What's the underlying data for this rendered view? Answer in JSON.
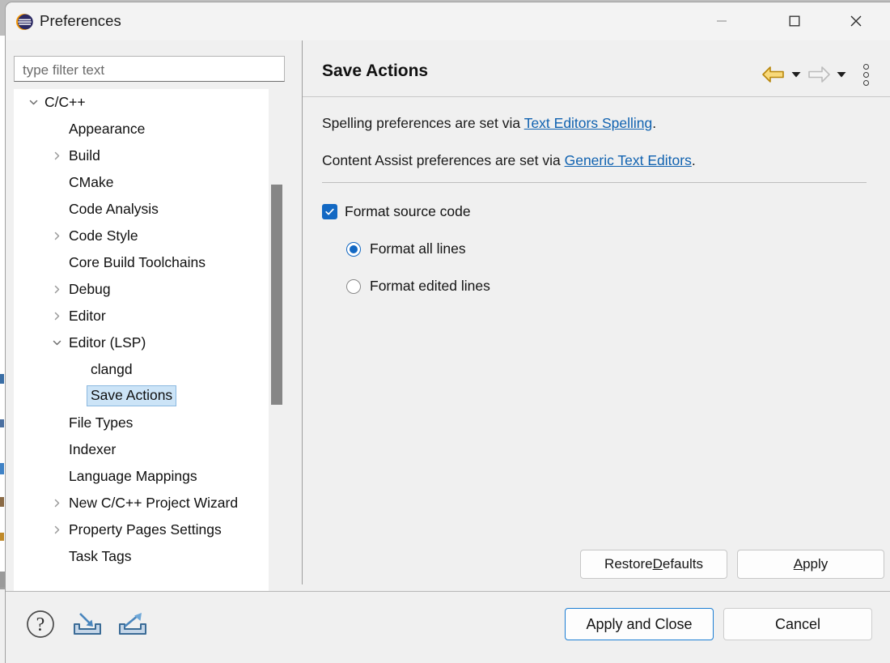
{
  "window": {
    "title": "Preferences",
    "app_icon": "eclipse-logo-icon",
    "controls": {
      "minimize": "minimize-icon",
      "maximize": "maximize-icon",
      "close": "close-icon"
    }
  },
  "sidebar": {
    "filter": {
      "value": "",
      "placeholder": "type filter text"
    },
    "tree": [
      {
        "label": "C/C++",
        "indent": 0,
        "twisty": "expanded",
        "selected": false
      },
      {
        "label": "Appearance",
        "indent": 1,
        "twisty": "none",
        "selected": false
      },
      {
        "label": "Build",
        "indent": 1,
        "twisty": "collapsed",
        "selected": false
      },
      {
        "label": "CMake",
        "indent": 1,
        "twisty": "none",
        "selected": false
      },
      {
        "label": "Code Analysis",
        "indent": 1,
        "twisty": "none",
        "selected": false
      },
      {
        "label": "Code Style",
        "indent": 1,
        "twisty": "collapsed",
        "selected": false
      },
      {
        "label": "Core Build Toolchains",
        "indent": 1,
        "twisty": "none",
        "selected": false
      },
      {
        "label": "Debug",
        "indent": 1,
        "twisty": "collapsed",
        "selected": false
      },
      {
        "label": "Editor",
        "indent": 1,
        "twisty": "collapsed",
        "selected": false
      },
      {
        "label": "Editor (LSP)",
        "indent": 1,
        "twisty": "expanded",
        "selected": false
      },
      {
        "label": "clangd",
        "indent": 2,
        "twisty": "none",
        "selected": false
      },
      {
        "label": "Save Actions",
        "indent": 2,
        "twisty": "none",
        "selected": true
      },
      {
        "label": "File Types",
        "indent": 1,
        "twisty": "none",
        "selected": false
      },
      {
        "label": "Indexer",
        "indent": 1,
        "twisty": "none",
        "selected": false
      },
      {
        "label": "Language Mappings",
        "indent": 1,
        "twisty": "none",
        "selected": false
      },
      {
        "label": "New C/C++ Project Wizard",
        "indent": 1,
        "twisty": "collapsed",
        "selected": false
      },
      {
        "label": "Property Pages Settings",
        "indent": 1,
        "twisty": "collapsed",
        "selected": false
      },
      {
        "label": "Task Tags",
        "indent": 1,
        "twisty": "none",
        "selected": false
      }
    ]
  },
  "page": {
    "title": "Save Actions",
    "nav": {
      "back_icon": "back-arrow-icon",
      "back_caret_icon": "chevron-down-icon",
      "forward_icon": "forward-arrow-icon",
      "forward_caret_icon": "chevron-down-icon",
      "menu_icon": "vertical-dots-menu-icon"
    },
    "descriptions": [
      {
        "before": "Spelling preferences are set via ",
        "link": "Text Editors Spelling",
        "after": "."
      },
      {
        "before": "Content Assist preferences are set via ",
        "link": "Generic Text Editors",
        "after": "."
      }
    ],
    "checkbox": {
      "label": "Format source code",
      "checked": true
    },
    "radios": [
      {
        "label": "Format all lines",
        "selected": true
      },
      {
        "label": "Format edited lines",
        "selected": false
      }
    ],
    "buttons": {
      "restore_defaults": {
        "pre": "Restore ",
        "mnemonic": "D",
        "post": "efaults"
      },
      "apply": {
        "pre": "",
        "mnemonic": "A",
        "post": "pply"
      }
    }
  },
  "footer": {
    "help_icon": "help-question-icon",
    "import_icon": "import-preferences-icon",
    "export_icon": "export-preferences-icon",
    "apply_and_close": "Apply and Close",
    "cancel": "Cancel"
  },
  "colors": {
    "accent_blue": "#1268c3",
    "link_blue": "#1062b0",
    "selection_bg": "#cce4f7",
    "selection_border": "#8bb8e0",
    "nav_back_gold": "#c99307",
    "nav_forward_gray": "#b5b5b5",
    "dialog_bg": "#f0f0f0",
    "titlebar_bg": "#f3f3f3"
  }
}
